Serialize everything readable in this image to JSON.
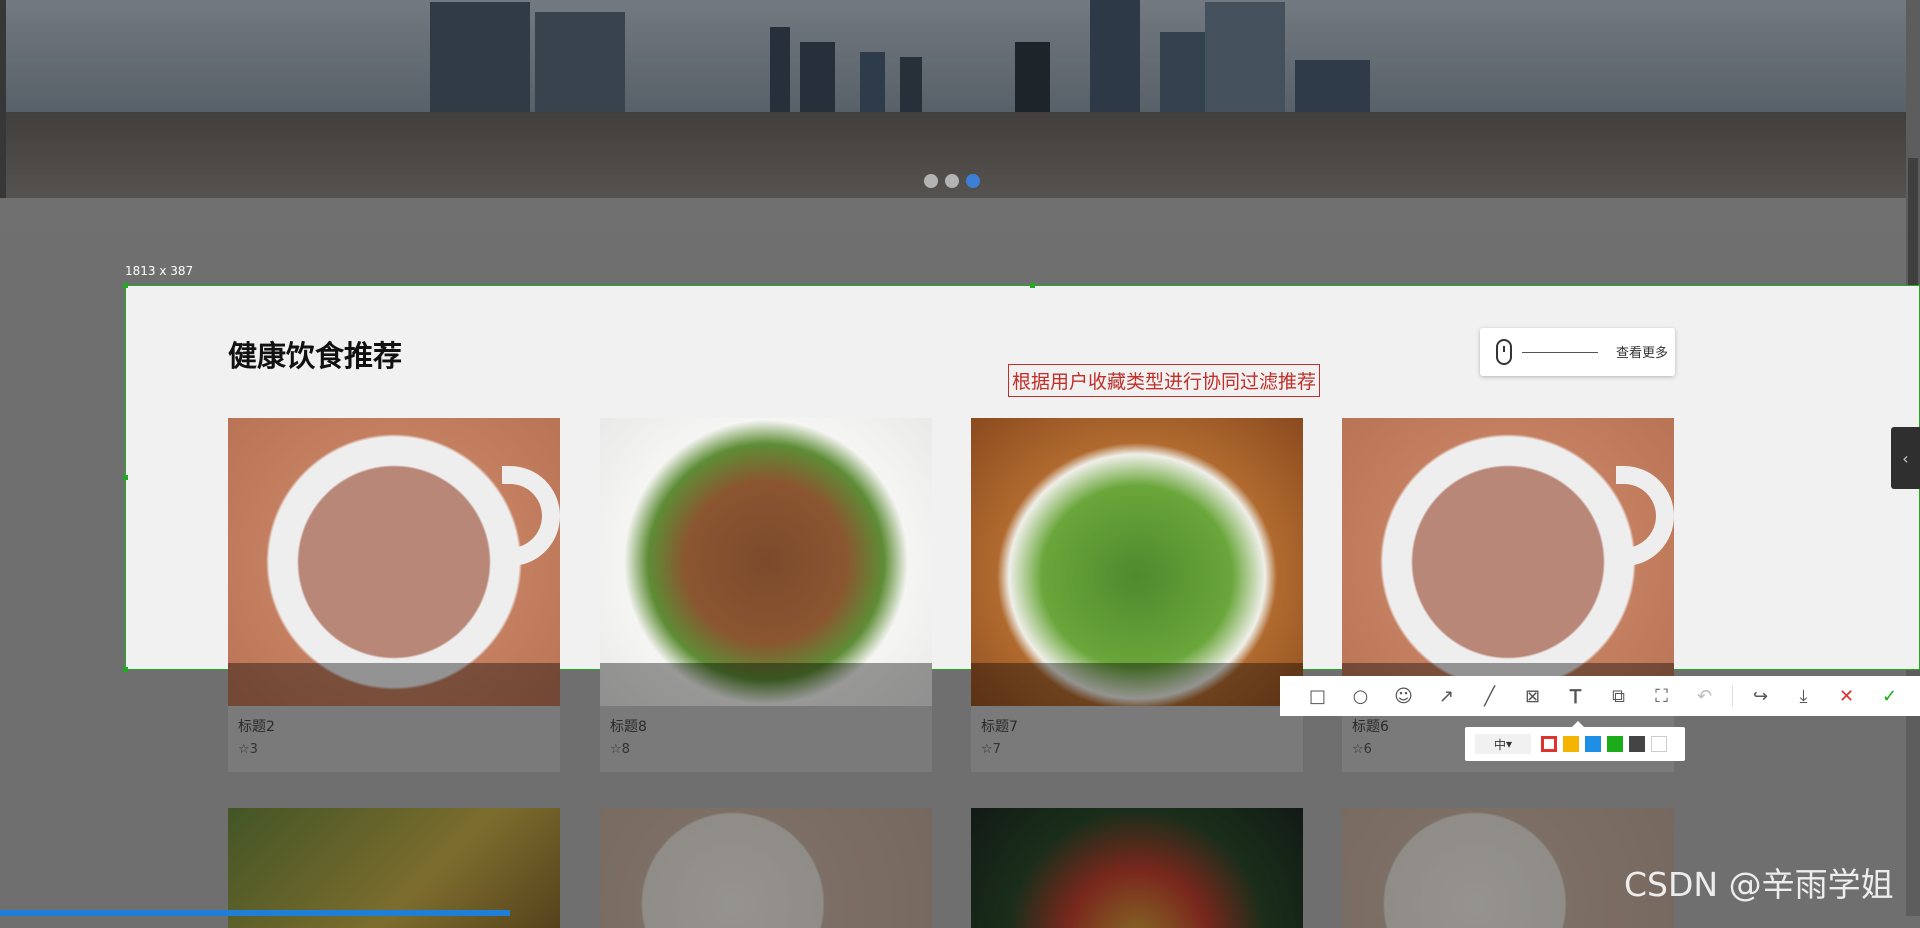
{
  "hero": {
    "slide_count": 3,
    "active_slide": 3
  },
  "selection": {
    "size_label": "1813 x 387"
  },
  "section": {
    "title": "健康饮食推荐",
    "more_label": "查看更多",
    "annotation": "根据用户收藏类型进行协同过滤推荐"
  },
  "cards_row1": [
    {
      "title": "标题2",
      "favorites": "☆3",
      "image": "milk-tea"
    },
    {
      "title": "标题8",
      "favorites": "☆8",
      "image": "stir-fry"
    },
    {
      "title": "标题7",
      "favorites": "☆7",
      "image": "green-beans-pork"
    },
    {
      "title": "标题6",
      "favorites": "☆6",
      "image": "milk-tea"
    }
  ],
  "cards_row2": [
    {
      "image": "salad"
    },
    {
      "image": "plate-with-flowers"
    },
    {
      "image": "vegetable-salad"
    },
    {
      "image": "plate-with-flowers"
    }
  ],
  "toolbar": {
    "tools": [
      "rectangle-icon",
      "ellipse-icon",
      "emoji-icon",
      "arrow-icon",
      "line-icon",
      "mosaic-icon",
      "text-icon",
      "pin-icon",
      "ocr-icon",
      "undo-icon",
      "share-icon",
      "download-icon",
      "close-icon",
      "confirm-icon"
    ]
  },
  "sub_toolbar": {
    "size": "中",
    "colors": [
      "#e0322d",
      "#f5b400",
      "#1e8fe6",
      "#1aad19",
      "#444444",
      "#ffffff"
    ],
    "selected_color": "#e0322d"
  },
  "watermark": "CSDN @辛雨学姐"
}
